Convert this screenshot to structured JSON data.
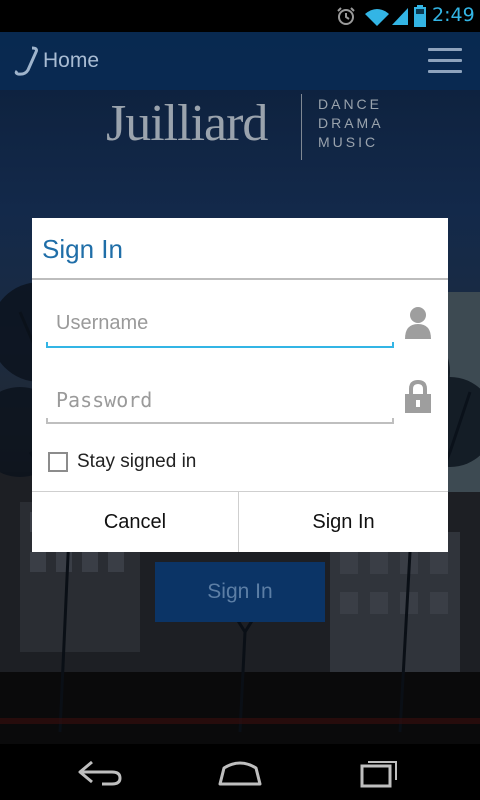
{
  "status_bar": {
    "time": "2:49",
    "icons": [
      "alarm-icon",
      "wifi-icon",
      "signal-icon",
      "battery-icon"
    ],
    "accent_color": "#33b5e5"
  },
  "action_bar": {
    "app_icon": "julliard-j-icon",
    "title": "Home",
    "menu_icon": "hamburger-menu-icon",
    "background_color": "#0c2b52"
  },
  "logo": {
    "wordmark": "Juilliard",
    "lines": [
      "DANCE",
      "DRAMA",
      "MUSIC"
    ]
  },
  "background": {
    "sign_in_button": "Sign In"
  },
  "dialog": {
    "title": "Sign In",
    "username": {
      "value": "",
      "placeholder": "Username",
      "icon": "person-icon"
    },
    "password": {
      "value": "",
      "placeholder": "Password",
      "icon": "lock-icon"
    },
    "stay_signed_in": {
      "label": "Stay signed in",
      "checked": false
    },
    "buttons": {
      "cancel": "Cancel",
      "sign_in": "Sign In"
    },
    "title_color": "#1f6ea8",
    "focus_color": "#33b5e5"
  },
  "nav_bar": {
    "icons": [
      "back-icon",
      "home-icon",
      "recent-apps-icon"
    ]
  }
}
